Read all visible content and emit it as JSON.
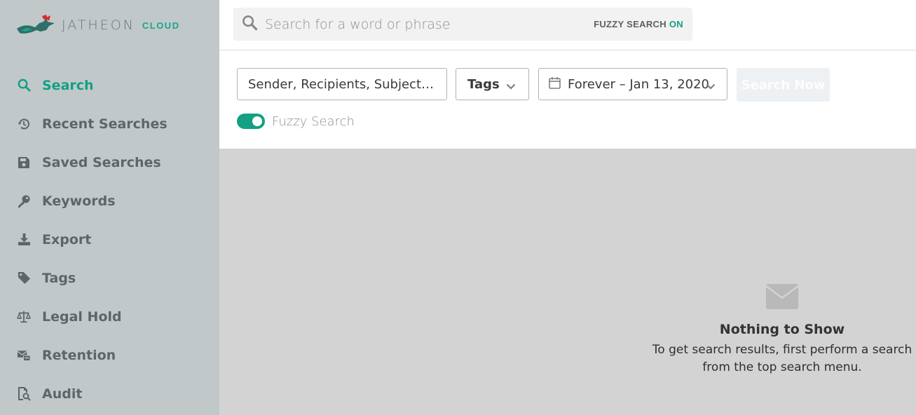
{
  "brand": {
    "name": "JATHEON",
    "suffix": "CLOUD",
    "accent": "#13a085",
    "logo_red": "#d8262d"
  },
  "sidebar": {
    "items": [
      {
        "label": "Search",
        "icon": "search-icon",
        "active": true
      },
      {
        "label": "Recent Searches",
        "icon": "history-icon",
        "active": false
      },
      {
        "label": "Saved Searches",
        "icon": "save-icon",
        "active": false
      },
      {
        "label": "Keywords",
        "icon": "key-icon",
        "active": false
      },
      {
        "label": "Export",
        "icon": "download-icon",
        "active": false
      },
      {
        "label": "Tags",
        "icon": "tag-icon",
        "active": false
      },
      {
        "label": "Legal Hold",
        "icon": "scale-icon",
        "active": false
      },
      {
        "label": "Retention",
        "icon": "retention-icon",
        "active": false
      },
      {
        "label": "Audit",
        "icon": "audit-icon",
        "active": false
      }
    ]
  },
  "topbar": {
    "search_placeholder": "Search for a word or phrase",
    "fuzzy_label": "FUZZY SEARCH",
    "fuzzy_state": "ON"
  },
  "filters": {
    "query_field": "Sender, Recipients, Subject, Bo...",
    "tags_label": "Tags",
    "date_range": "Forever – Jan 13, 2020",
    "search_button": "Search Now",
    "fuzzy_toggle_label": "Fuzzy Search",
    "fuzzy_enabled": true
  },
  "empty_state": {
    "title": "Nothing to Show",
    "message": "To get search results, first perform a search from the top search menu."
  }
}
